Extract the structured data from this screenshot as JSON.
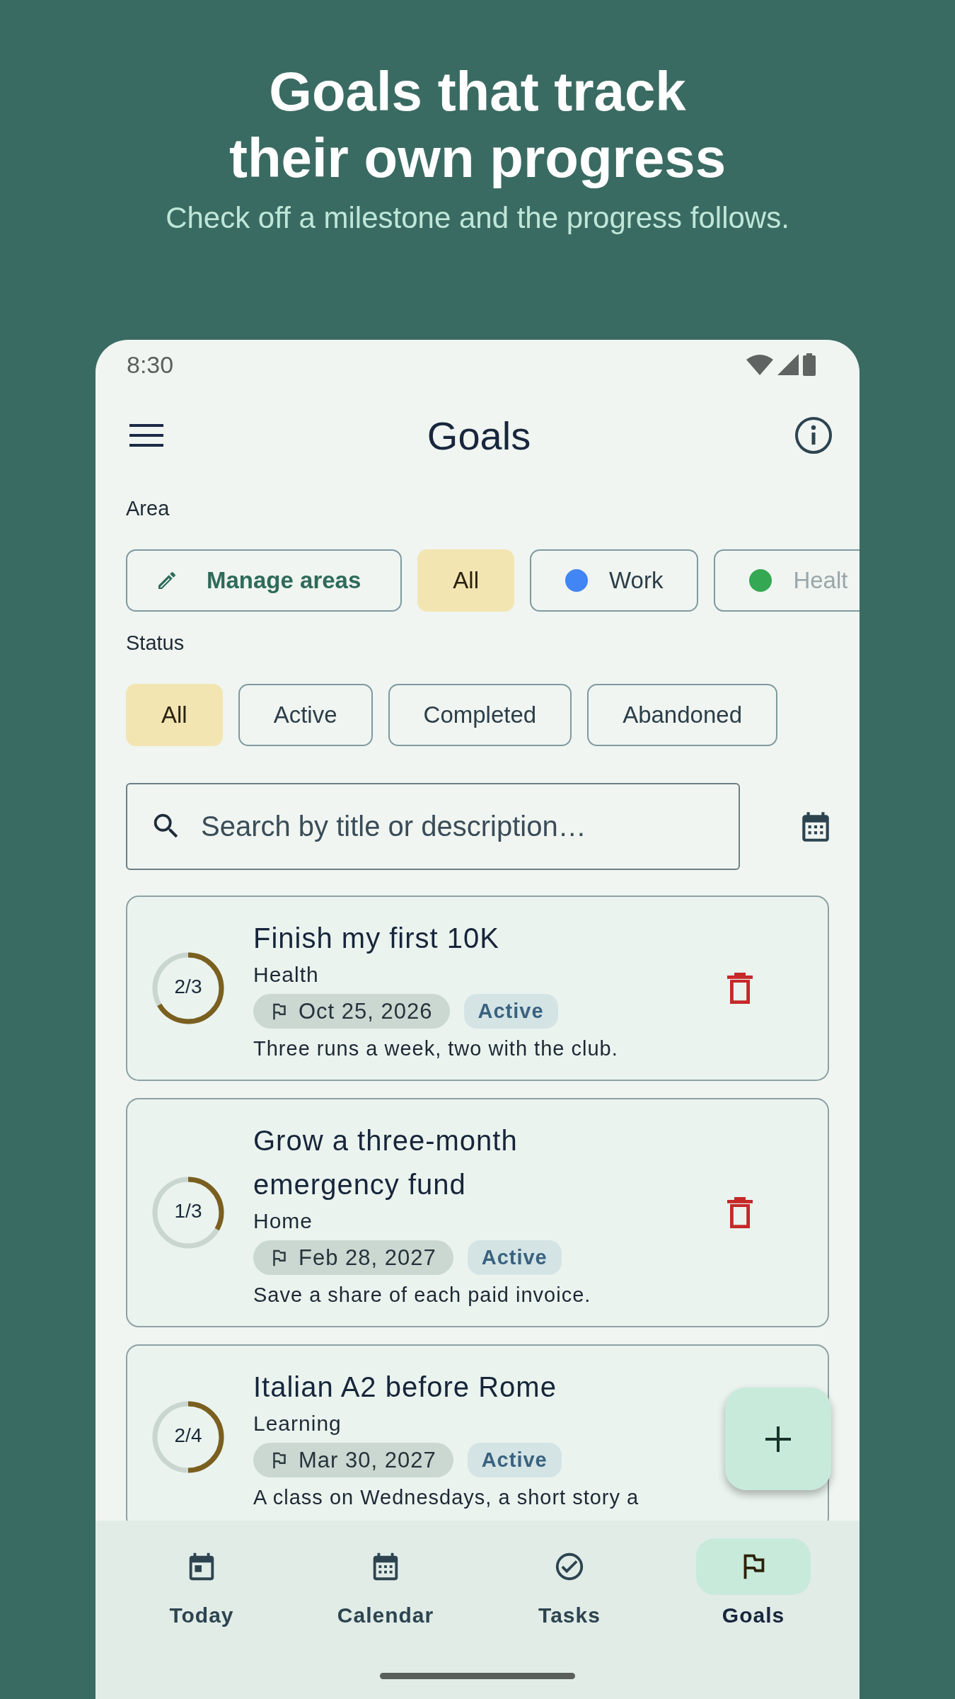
{
  "hero": {
    "title_lines": [
      "Goals that track",
      "their own progress"
    ],
    "subtitle": "Check off a milestone and the progress follows."
  },
  "status_bar": {
    "time": "8:30"
  },
  "app_bar": {
    "title": "Goals"
  },
  "area_filter": {
    "label": "Area",
    "chips": [
      {
        "kind": "action",
        "label": "Manage areas",
        "selected": false
      },
      {
        "kind": "filter",
        "label": "All",
        "selected": true
      },
      {
        "kind": "area",
        "label": "Work",
        "color": "#4285f4",
        "selected": false
      },
      {
        "kind": "area",
        "label": "Healt",
        "color": "#34a853",
        "selected": false
      }
    ]
  },
  "status_filter": {
    "label": "Status",
    "chips": [
      {
        "label": "All",
        "selected": true
      },
      {
        "label": "Active",
        "selected": false
      },
      {
        "label": "Completed",
        "selected": false
      },
      {
        "label": "Abandoned",
        "selected": false
      }
    ]
  },
  "search": {
    "placeholder": "Search by title or description…"
  },
  "goals": [
    {
      "progress": "2/3",
      "level": 0.667,
      "title": "Finish my first 10K",
      "area": "Health",
      "due": "Oct 25, 2026",
      "status": "Active",
      "description": "Three runs a week, two with the club."
    },
    {
      "progress": "1/3",
      "level": 0.333,
      "title": "Grow a three-month emergency fund",
      "area": "Home",
      "due": "Feb 28, 2027",
      "status": "Active",
      "description": "Save a share of each paid invoice."
    },
    {
      "progress": "2/4",
      "level": 0.5,
      "title": "Italian A2 before Rome",
      "area": "Learning",
      "due": "Mar 30, 2027",
      "status": "Active",
      "description": "A class on Wednesdays, a short story a"
    }
  ],
  "nav": [
    {
      "label": "Today",
      "selected": false
    },
    {
      "label": "Calendar",
      "selected": false
    },
    {
      "label": "Tasks",
      "selected": false
    },
    {
      "label": "Goals",
      "selected": true
    }
  ]
}
